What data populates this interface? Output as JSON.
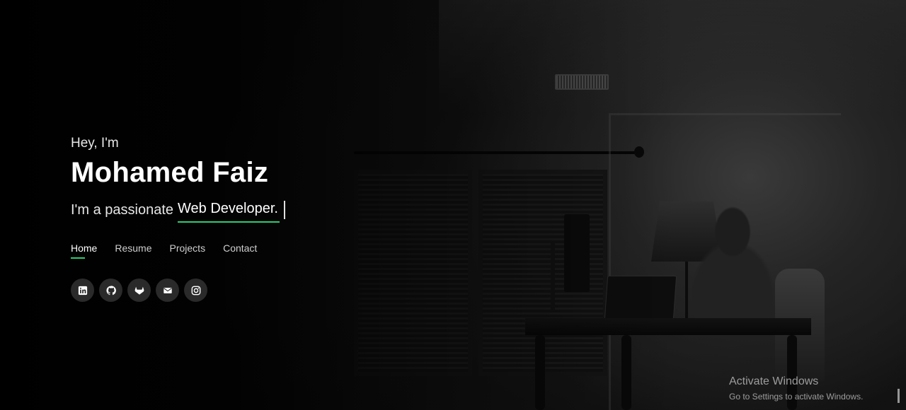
{
  "hero": {
    "greeting": "Hey, I'm",
    "name": "Mohamed Faiz",
    "tagline_prefix": "I'm a passionate",
    "role": "Web Developer."
  },
  "nav": {
    "items": [
      "Home",
      "Resume",
      "Projects",
      "Contact"
    ],
    "active": "Home"
  },
  "socials": [
    {
      "name": "linkedin-icon"
    },
    {
      "name": "github-icon"
    },
    {
      "name": "gitlab-icon"
    },
    {
      "name": "mail-icon"
    },
    {
      "name": "instagram-icon"
    }
  ],
  "watermark": {
    "title": "Activate Windows",
    "subtitle": "Go to Settings to activate Windows."
  },
  "colors": {
    "accent": "#2ecc71",
    "background": "#050505",
    "text": "#ffffff",
    "social_bg": "#2a2a2a"
  }
}
